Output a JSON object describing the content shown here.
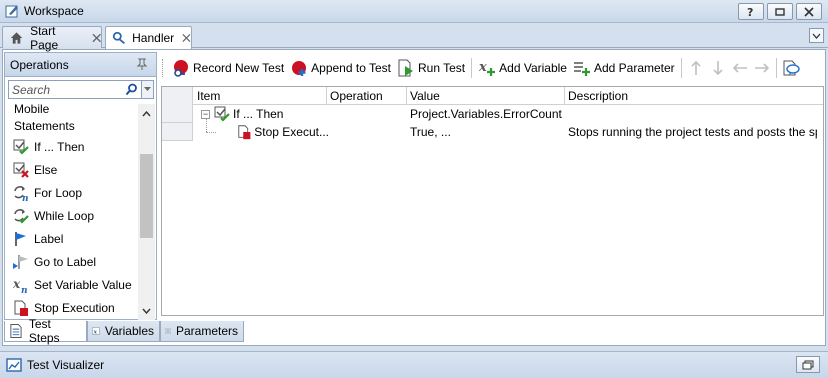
{
  "window": {
    "title": "Workspace",
    "buttons": [
      "help-icon",
      "restore-icon",
      "close-icon"
    ]
  },
  "doc_tabs": [
    {
      "label": "Start Page",
      "icon": "home-icon",
      "active": false
    },
    {
      "label": "Handler",
      "icon": "keyword-test-icon",
      "active": true
    }
  ],
  "operations_panel": {
    "title": "Operations",
    "search_placeholder": "Search",
    "categories": [
      {
        "label": "Mobile"
      },
      {
        "label": "Statements"
      }
    ],
    "items": [
      {
        "label": "If ... Then",
        "icon": "if-then-icon"
      },
      {
        "label": "Else",
        "icon": "else-icon"
      },
      {
        "label": "For Loop",
        "icon": "for-loop-icon"
      },
      {
        "label": "While Loop",
        "icon": "while-loop-icon"
      },
      {
        "label": "Label",
        "icon": "flag-icon"
      },
      {
        "label": "Go to Label",
        "icon": "goto-label-icon"
      },
      {
        "label": "Set Variable Value",
        "icon": "set-variable-icon"
      },
      {
        "label": "Stop Execution",
        "icon": "stop-execution-icon"
      }
    ]
  },
  "bottom_tabs": [
    {
      "label": "Test Steps",
      "active": true
    },
    {
      "label": "Variables",
      "active": false
    },
    {
      "label": "Parameters",
      "active": false
    }
  ],
  "toolbar": {
    "record_new_test": "Record New Test",
    "append_to_test": "Append to Test",
    "run_test": "Run Test",
    "add_variable": "Add Variable",
    "add_parameter": "Add Parameter"
  },
  "grid": {
    "columns": [
      "Item",
      "Operation",
      "Value",
      "Description"
    ],
    "rows": [
      {
        "item": "If ... Then",
        "operation": "",
        "value": "Project.Variables.ErrorCount ...",
        "description": ""
      },
      {
        "item": "Stop Execut...",
        "operation": "",
        "value": "True, ...",
        "description": "Stops running the project tests and posts the sp..."
      }
    ]
  },
  "visualizer": {
    "title": "Test Visualizer"
  },
  "colors": {
    "accent": "#c9d8ea",
    "check_green": "#2e9b2e",
    "stop_red": "#cc1122"
  }
}
